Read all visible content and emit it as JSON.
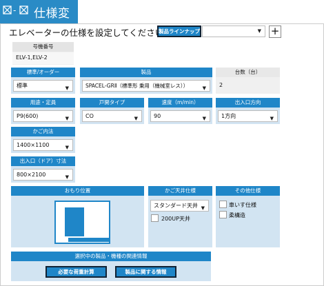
{
  "titlebar": {
    "title": "仕様変更"
  },
  "prompt": "エレベーターの仕様を設定してください。",
  "lineup": {
    "button_label": "製品ラインナップ",
    "selected": ""
  },
  "machine_no": {
    "label": "号機番号",
    "value": "ELV-1,ELV-2"
  },
  "standard_order": {
    "label": "標準/オーダー",
    "value": "標準"
  },
  "product": {
    "label": "製品",
    "value": "SPACEL-GRⅡ（標準形 乗用（機械室レス））"
  },
  "units": {
    "label": "台数（台）",
    "value": "2"
  },
  "usage": {
    "label": "用途・定員",
    "value": "P9(600)"
  },
  "door_type": {
    "label": "戸開タイプ",
    "value": "CO"
  },
  "speed": {
    "label": "速度（m/min）",
    "value": "90"
  },
  "entrance_dir": {
    "label": "出入口方向",
    "value": "1方向"
  },
  "cage_size": {
    "label": "かご内法",
    "value": "1400×1100"
  },
  "door_size": {
    "label": "出入口（ドア）寸法",
    "value": "800×2100"
  },
  "weight_position": {
    "label": "おもり位置"
  },
  "ceiling": {
    "label": "かご天井仕様",
    "value": "スタンダード天井",
    "option_200up": "200UP天井"
  },
  "other": {
    "label": "その他仕様",
    "wheelchair": "車いす仕様",
    "seismic": "柔構造"
  },
  "related": {
    "label": "選択中の製品・機種の関連情報",
    "calc_button": "必要な荷重計算",
    "info_button": "製品に関する情報"
  }
}
